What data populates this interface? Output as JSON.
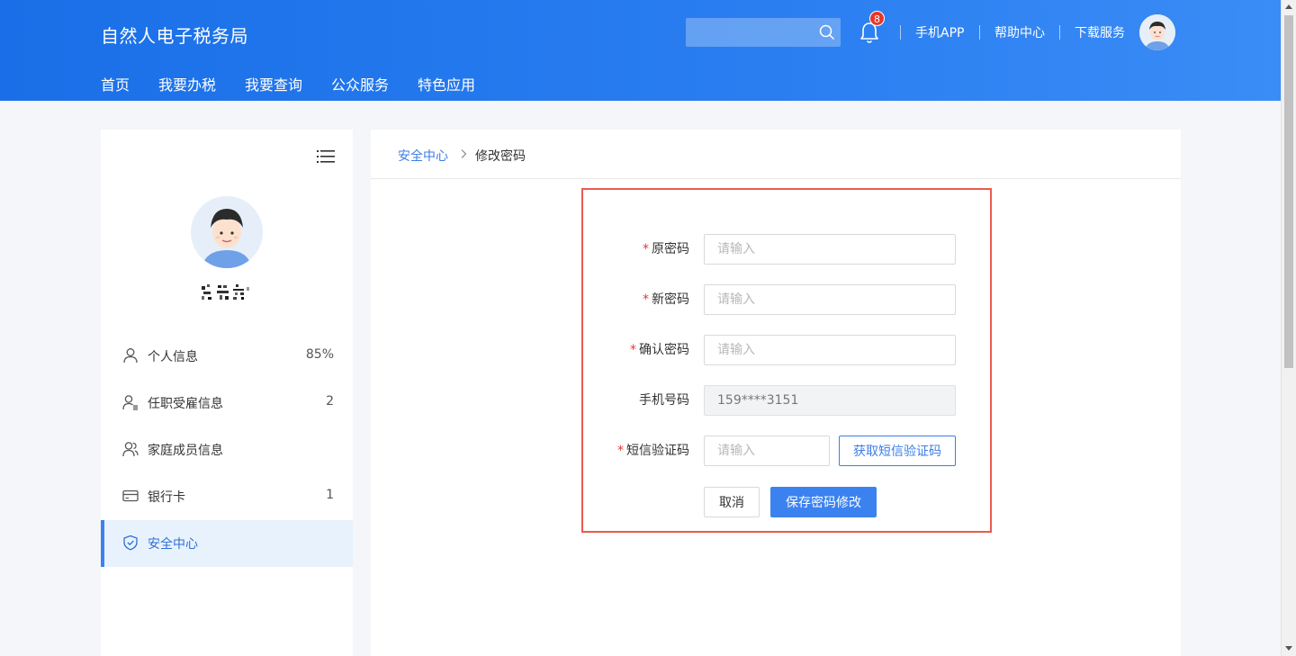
{
  "header": {
    "app_title": "自然人电子税务局",
    "notification_count": "8",
    "links": [
      "手机APP",
      "帮助中心",
      "下载服务"
    ],
    "nav": [
      "首页",
      "我要办税",
      "我要查询",
      "公众服务",
      "特色应用"
    ]
  },
  "sidebar": {
    "items": [
      {
        "label": "个人信息",
        "count": "85%",
        "icon": "user-icon"
      },
      {
        "label": "任职受雇信息",
        "count": "2",
        "icon": "user-list-icon"
      },
      {
        "label": "家庭成员信息",
        "count": "",
        "icon": "family-icon"
      },
      {
        "label": "银行卡",
        "count": "1",
        "icon": "card-icon"
      },
      {
        "label": "安全中心",
        "count": "",
        "icon": "shield-icon",
        "active": true
      }
    ]
  },
  "breadcrumb": {
    "parent": "安全中心",
    "current": "修改密码"
  },
  "form": {
    "old_password": {
      "label": "原密码",
      "required": "*",
      "placeholder": "请输入"
    },
    "new_password": {
      "label": "新密码",
      "required": "*",
      "placeholder": "请输入"
    },
    "confirm_password": {
      "label": "确认密码",
      "required": "*",
      "placeholder": "请输入"
    },
    "phone": {
      "label": "手机号码",
      "value": "159****3151"
    },
    "sms_code": {
      "label": "短信验证码",
      "required": "*",
      "placeholder": "请输入",
      "get_code_label": "获取短信验证码"
    },
    "cancel_label": "取消",
    "save_label": "保存密码修改"
  },
  "colors": {
    "header_blue": "#1a6fe8",
    "accent": "#3b82f0",
    "required_red": "#e8372b",
    "highlight_border": "#ea5a4e"
  }
}
